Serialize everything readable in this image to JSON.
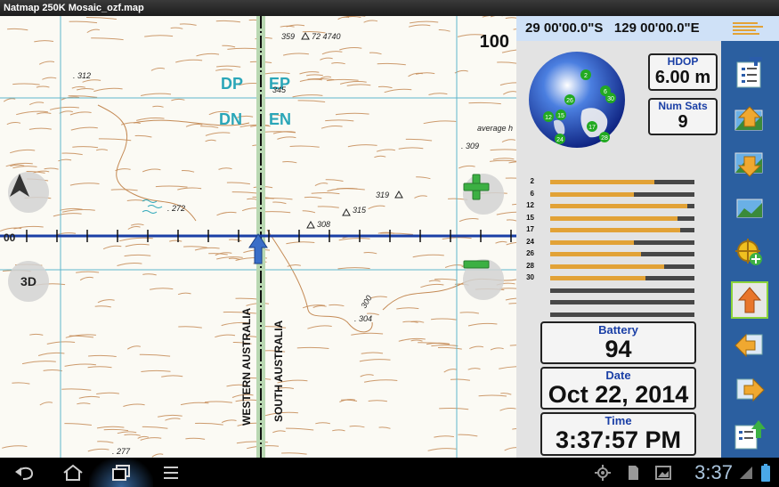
{
  "window": {
    "title": "Natmap 250K Mosaic_ozf.map"
  },
  "map": {
    "zoom_level": "100",
    "grid_labels": [
      "DP",
      "EP",
      "DN",
      "EN"
    ],
    "spot_heights": [
      "359",
      "72 4740",
      ". 312",
      "345",
      "average h",
      ". 309",
      "319",
      "315",
      ". 272",
      "308",
      ". 304",
      ". 277",
      "300"
    ],
    "latitude_label": "00",
    "border_labels": [
      "WESTERN AUSTRALIA",
      "SOUTH AUSTRALIA"
    ],
    "buttons": {
      "compass": "compass",
      "view_3d": "3D",
      "zoom_in": "+",
      "zoom_out": "−"
    }
  },
  "panel": {
    "coordinates": "29 00'00.0\"S   129 00'00.0\"E",
    "satellite_ids": [
      "2",
      "26",
      "6",
      "30",
      "12",
      "15",
      "17",
      "28",
      "24"
    ],
    "hdop": {
      "label": "HDOP",
      "value": "6.00 m"
    },
    "num_sats": {
      "label": "Num Sats",
      "value": "9"
    },
    "satellite_signals": [
      {
        "id": "2",
        "level": 0.72
      },
      {
        "id": "6",
        "level": 0.58
      },
      {
        "id": "12",
        "level": 0.95
      },
      {
        "id": "15",
        "level": 0.88
      },
      {
        "id": "17",
        "level": 0.9
      },
      {
        "id": "24",
        "level": 0.58
      },
      {
        "id": "26",
        "level": 0.63
      },
      {
        "id": "28",
        "level": 0.79
      },
      {
        "id": "30",
        "level": 0.66
      },
      {
        "id": "",
        "level": 0
      },
      {
        "id": "",
        "level": 0
      },
      {
        "id": "",
        "level": 0
      }
    ],
    "battery": {
      "label": "Battery",
      "value": "94"
    },
    "date": {
      "label": "Date",
      "value": "Oct 22, 2014"
    },
    "time": {
      "label": "Time",
      "value": "3:37:57 PM"
    }
  },
  "toolbar": {
    "icons": [
      "menu-icon",
      "waypoint-list-icon",
      "map-up-icon",
      "map-down-icon",
      "map-image-icon",
      "gps-add-icon",
      "orange-up-arrow-icon",
      "previous-map-icon",
      "next-map-icon",
      "export-icon"
    ]
  },
  "statusbar": {
    "clock": "3:37"
  },
  "colors": {
    "grid": "#5fb6cc",
    "contour": "#c48a55",
    "track": "#1a3fa6",
    "accent": "#e2a236"
  }
}
